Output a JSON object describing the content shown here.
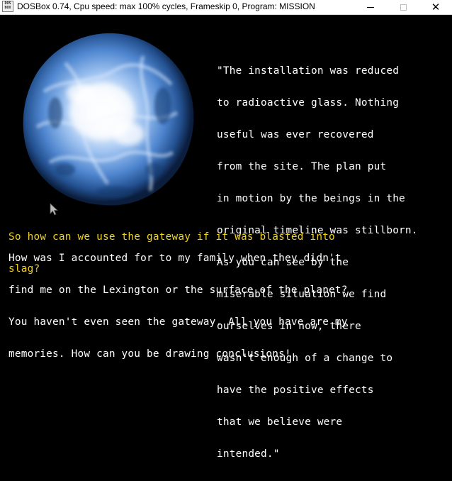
{
  "window": {
    "title": "DOSBox 0.74, Cpu speed: max 100% cycles, Frameskip  0, Program:  MISSION",
    "icon_text_top": "DOS",
    "icon_text_bottom": "BOX"
  },
  "scene": {
    "image_icon": "glowing-blue-planet-icon",
    "quote_lines": [
      "\"The installation was reduced",
      "to radioactive glass. Nothing",
      "useful was ever recovered",
      "from the site. The plan put",
      "in motion by the beings in the",
      "original timeline was stillborn.",
      "As you can see by the",
      "miserable situation we find",
      "ourselves in now, there",
      "wasn't enough of a change to",
      "have the positive effects",
      "that we believe were",
      "intended.\""
    ],
    "question_lines": [
      "So how can we use the gateway if it was blasted into",
      "slag?"
    ],
    "response_lines": [
      "How was I accounted for to my family when they didn't",
      "find me on the Lexington or the surface of the planet?",
      "You haven't even seen the gateway. All you have are my",
      "memories. How can you be drawing conclusions!"
    ]
  },
  "colors": {
    "background": "#000000",
    "text": "#ffffff",
    "question": "#f0d224",
    "planet_core": "#ffffff",
    "planet_mid": "#6fa6e6",
    "planet_edge": "#1b3f86"
  }
}
